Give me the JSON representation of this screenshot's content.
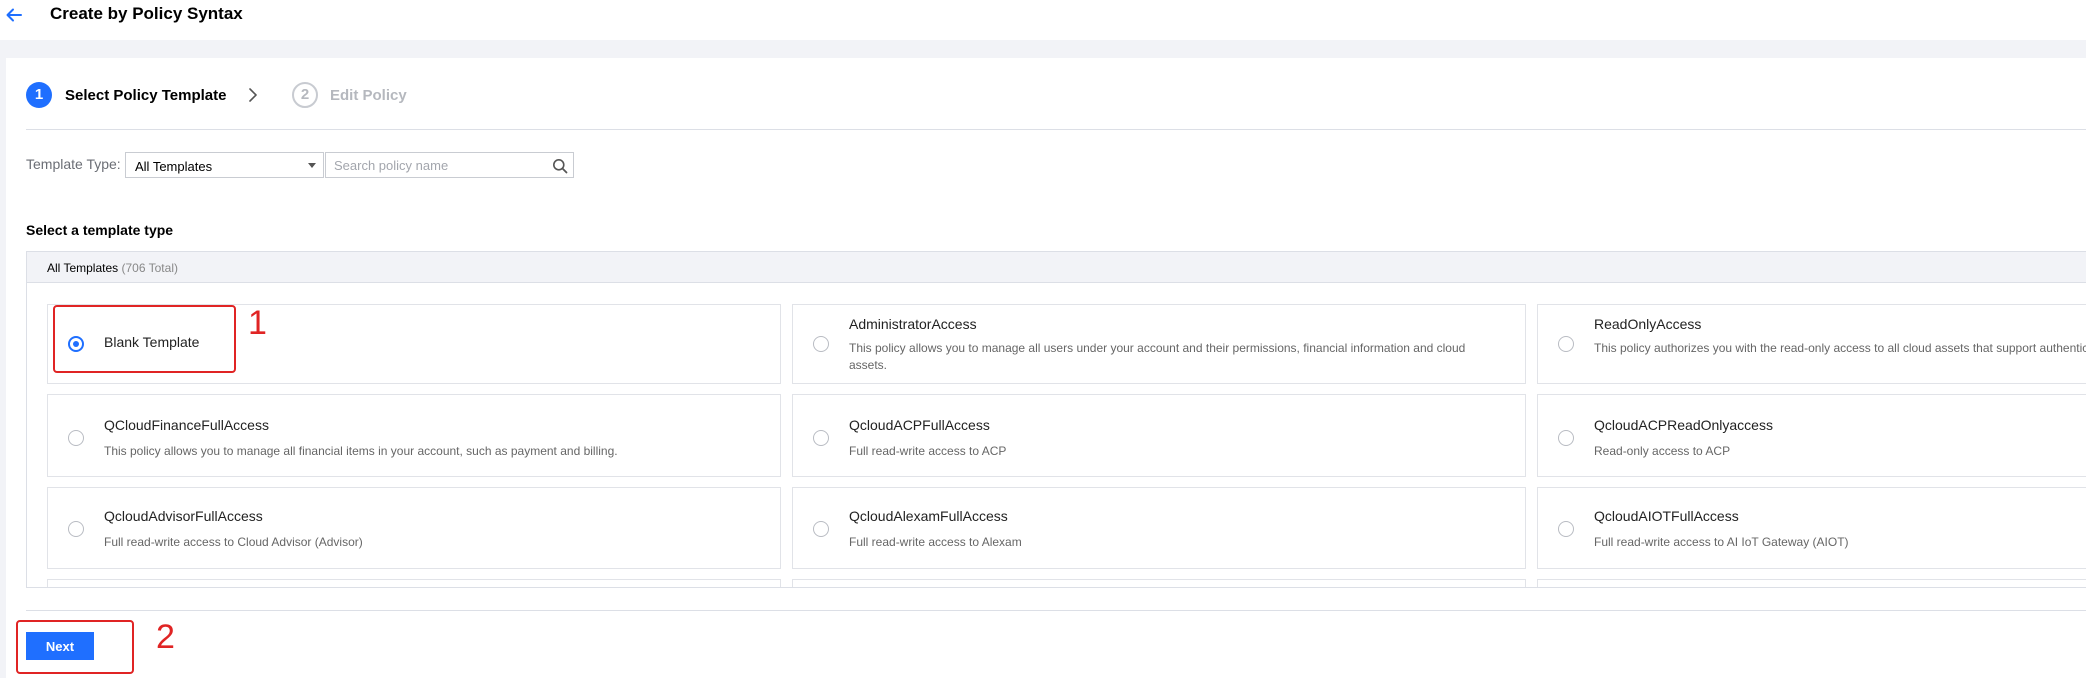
{
  "header": {
    "title": "Create by Policy Syntax"
  },
  "steps": [
    {
      "number": "1",
      "label": "Select Policy Template",
      "state": "active"
    },
    {
      "number": "2",
      "label": "Edit Policy",
      "state": "inactive"
    }
  ],
  "filter": {
    "type_label": "Template Type:",
    "type_value": "All Templates",
    "search_placeholder": "Search policy name"
  },
  "section_title": "Select a template type",
  "panel": {
    "header_label": "All Templates",
    "header_count": "(706 Total)"
  },
  "templates": [
    {
      "title": "Blank Template",
      "desc": "",
      "selected": true
    },
    {
      "title": "AdministratorAccess",
      "desc": "This policy allows you to manage all users under your account and their permissions, financial information and cloud assets.",
      "selected": false
    },
    {
      "title": "ReadOnlyAccess",
      "desc": "This policy authorizes you with the read-only access to all cloud assets that support authentication in your account.",
      "selected": false
    },
    {
      "title": "QCloudFinanceFullAccess",
      "desc": "This policy allows you to manage all financial items in your account, such as payment and billing.",
      "selected": false
    },
    {
      "title": "QcloudACPFullAccess",
      "desc": "Full read-write access to ACP",
      "selected": false
    },
    {
      "title": "QcloudACPReadOnlyaccess",
      "desc": "Read-only access to ACP",
      "selected": false
    },
    {
      "title": "QcloudAdvisorFullAccess",
      "desc": "Full read-write access to Cloud Advisor (Advisor)",
      "selected": false
    },
    {
      "title": "QcloudAlexamFullAccess",
      "desc": "Full read-write access to Alexam",
      "selected": false
    },
    {
      "title": "QcloudAIOTFullAccess",
      "desc": "Full read-write access to AI IoT Gateway (AIOT)",
      "selected": false
    }
  ],
  "footer": {
    "next_label": "Next"
  },
  "annotations": {
    "first": "1",
    "second": "2"
  },
  "colors": {
    "primary": "#1f6fff",
    "annotation": "#e02424",
    "band": "#f2f3f7"
  },
  "icons": {
    "back": "back-arrow-icon",
    "chevron": "chevron-right-icon",
    "search": "search-icon",
    "caret": "caret-down-icon"
  }
}
